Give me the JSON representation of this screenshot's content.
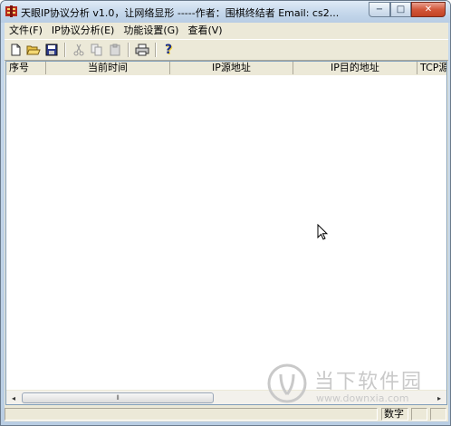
{
  "window": {
    "title": "天眼IP协议分析 v1.0，让网络显形 -----作者：围棋终结者  Email: cs2...",
    "minimize_glyph": "−",
    "maximize_glyph": "□",
    "close_glyph": "✕"
  },
  "menu": {
    "items": [
      {
        "label": "文件(F)"
      },
      {
        "label": "IP协议分析(E)"
      },
      {
        "label": "功能设置(G)"
      },
      {
        "label": "查看(V)"
      }
    ]
  },
  "toolbar": {
    "buttons": [
      "new-file-icon",
      "open-folder-icon",
      "save-icon",
      "cut-icon",
      "copy-icon",
      "paste-icon",
      "print-icon",
      "help-icon"
    ],
    "help_glyph": "?"
  },
  "table": {
    "columns": [
      "序号",
      "当前时间",
      "IP源地址",
      "IP目的地址",
      "TCP源"
    ],
    "rows": []
  },
  "scrollbar": {
    "left_glyph": "◂",
    "right_glyph": "▸",
    "thumb_grip": "⦀"
  },
  "statusbar": {
    "panes": [
      "",
      "数字",
      "",
      ""
    ]
  },
  "watermark": {
    "brand": "当下软件园",
    "url": "www.downxia.com",
    "color": "#c9c9c9"
  },
  "colors": {
    "titlebar": "#c3d6ea",
    "close_button": "#d2573a",
    "chrome": "#ece9d8"
  }
}
